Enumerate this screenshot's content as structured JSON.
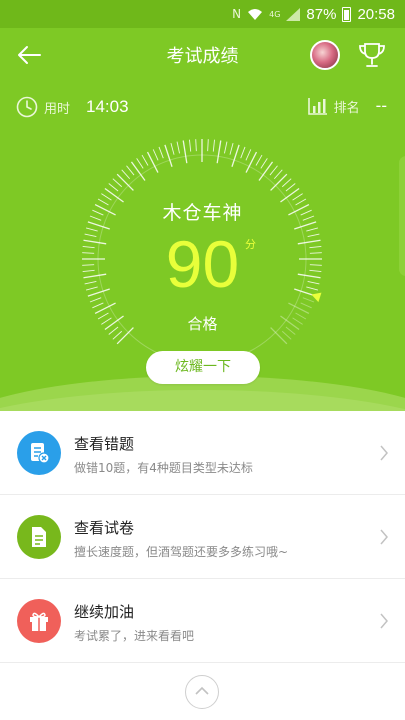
{
  "status_bar": {
    "nfc_icon": "N",
    "network_type": "4G",
    "battery_percent": "87%",
    "time": "20:58"
  },
  "header": {
    "title": "考试成绩",
    "back_icon": "arrow-left-icon",
    "trophy_icon": "trophy-icon"
  },
  "stats": {
    "time_label": "用时",
    "time_value": "14:03",
    "rank_label": "排名",
    "rank_value": "--"
  },
  "result": {
    "nickname": "木仓车神",
    "score": "90",
    "score_unit": "分",
    "status": "合格",
    "share_button": "炫耀一下",
    "gauge_fraction": 0.9
  },
  "menu": [
    {
      "title": "查看错题",
      "subtitle": "做错10题，有4种题目类型未达标",
      "color": "#2a9fe9",
      "icon": "wrong-questions-icon"
    },
    {
      "title": "查看试卷",
      "subtitle": "擅长速度题，但酒驾题还要多多练习哦~",
      "color": "#78b81c",
      "icon": "exam-paper-icon"
    },
    {
      "title": "继续加油",
      "subtitle": "考试累了，进来看看吧",
      "color": "#f0605a",
      "icon": "gift-icon"
    }
  ],
  "colors": {
    "brand_green": "#7ec925",
    "score_yellow": "#e8ff3a"
  }
}
